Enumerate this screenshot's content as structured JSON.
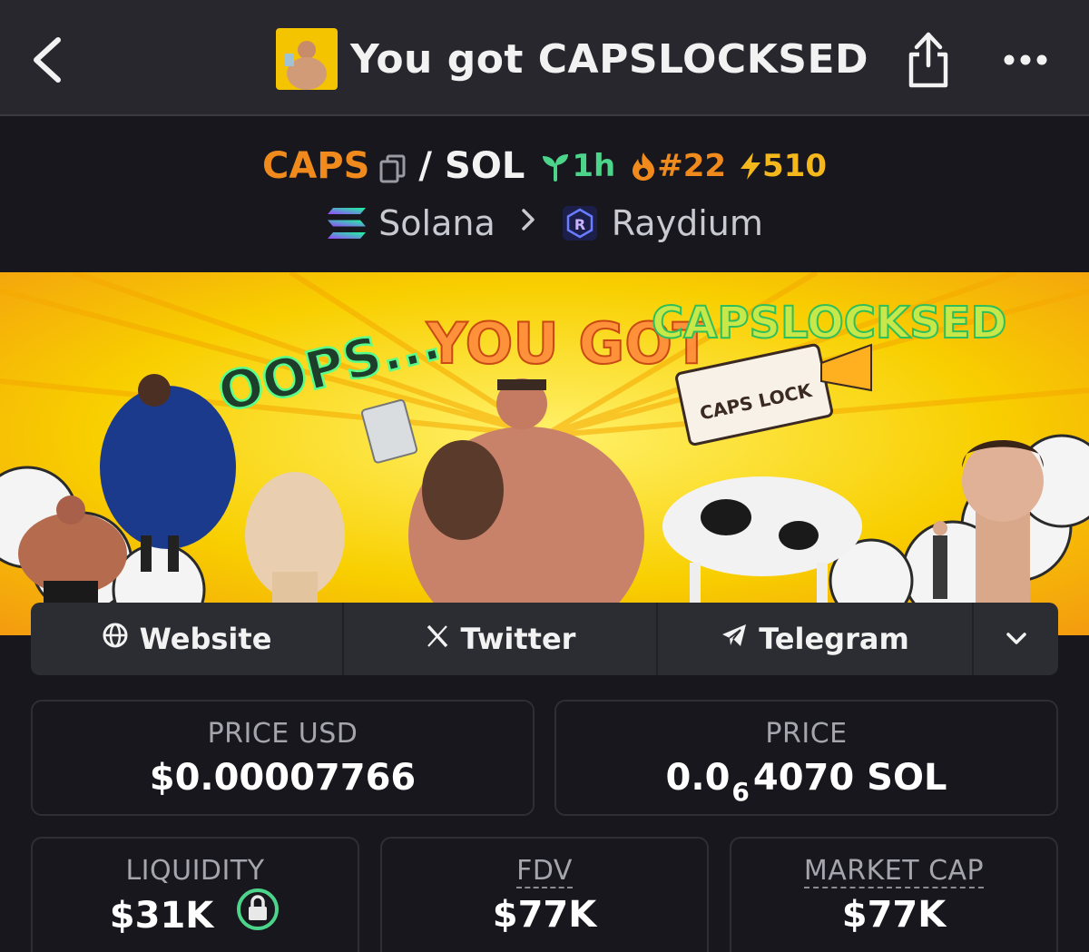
{
  "header": {
    "title": "You got CAPSLOCKSED"
  },
  "pair": {
    "base": "CAPS",
    "slash": "/",
    "quote": "SOL",
    "age": "1h",
    "rank": "#22",
    "boosts": "510"
  },
  "route": {
    "chain": "Solana",
    "dex": "Raydium"
  },
  "banner": {
    "texts": [
      "OOPS...",
      "YOU GOT",
      "CAPSLOCKSED"
    ],
    "keycap": "CAPS LOCK"
  },
  "links": {
    "website": "Website",
    "twitter": "Twitter",
    "telegram": "Telegram"
  },
  "stats": {
    "price_usd_label": "PRICE USD",
    "price_usd": "$0.00007766",
    "price_label": "PRICE",
    "price_prefix": "0.0",
    "price_zeros": "6",
    "price_suffix": "4070 SOL",
    "liquidity_label": "LIQUIDITY",
    "liquidity": "$31K",
    "fdv_label": "FDV",
    "fdv": "$77K",
    "mcap_label": "MARKET CAP",
    "mcap": "$77K"
  },
  "colors": {
    "accent_orange": "#f08a1c",
    "age_green": "#4bd48a",
    "boost_yellow": "#f5b81c",
    "lock_green": "#4bd48a"
  },
  "icons": [
    "back-arrow-icon",
    "share-icon",
    "more-dots-icon",
    "copy-icon",
    "seedling-icon",
    "flame-icon",
    "bolt-icon",
    "solana-icon",
    "chevron-right-icon",
    "raydium-icon",
    "globe-icon",
    "x-logo-icon",
    "telegram-icon",
    "chevron-down-icon",
    "lock-icon"
  ]
}
